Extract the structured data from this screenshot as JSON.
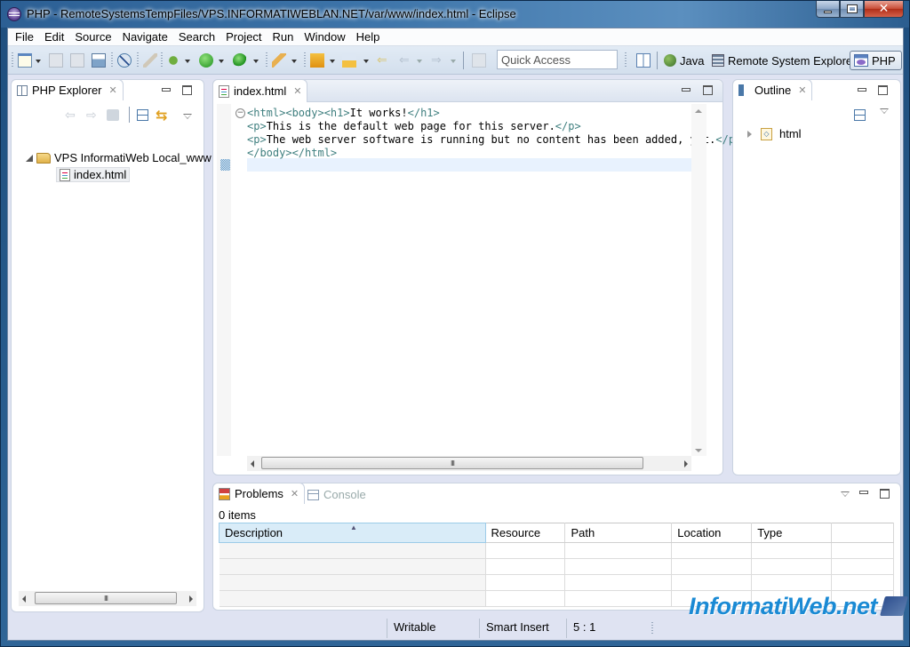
{
  "window": {
    "title": "PHP - RemoteSystemsTempFiles/VPS.INFORMATIWEBLAN.NET/var/www/index.html - Eclipse",
    "close_glyph": "✕"
  },
  "menu": [
    "File",
    "Edit",
    "Source",
    "Navigate",
    "Search",
    "Project",
    "Run",
    "Window",
    "Help"
  ],
  "toolbar": {
    "quick_access_placeholder": "Quick Access",
    "perspectives": [
      {
        "label": "Java",
        "active": false
      },
      {
        "label": "Remote System Explorer",
        "active": false
      },
      {
        "label": "PHP",
        "active": true
      }
    ]
  },
  "explorer": {
    "tab_label": "PHP Explorer",
    "close_glyph": "✕",
    "tree": [
      {
        "label": "VPS InformatiWeb Local_www",
        "type": "folder",
        "expanded": true
      },
      {
        "label": "index.html",
        "type": "file",
        "selected": true
      }
    ],
    "scroll_thumb": "III"
  },
  "editor": {
    "tab_label": "index.html",
    "close_glyph": "✕",
    "lines": [
      [
        {
          "t": "tag",
          "v": "<html><body><h1>"
        },
        {
          "t": "txt",
          "v": "It works!"
        },
        {
          "t": "tag",
          "v": "</h1>"
        }
      ],
      [
        {
          "t": "tag",
          "v": "<p>"
        },
        {
          "t": "txt",
          "v": "This is the default web page for this server."
        },
        {
          "t": "tag",
          "v": "</p>"
        }
      ],
      [
        {
          "t": "tag",
          "v": "<p>"
        },
        {
          "t": "txt",
          "v": "The web server software is running but no content has been added, yet."
        },
        {
          "t": "tag",
          "v": "</p>"
        }
      ],
      [
        {
          "t": "tag",
          "v": "</body></html>"
        }
      ],
      []
    ],
    "fold_glyph": "−",
    "scroll_thumb": "III"
  },
  "outline": {
    "tab_label": "Outline",
    "close_glyph": "✕",
    "items": [
      {
        "label": "html"
      }
    ]
  },
  "problems": {
    "tab_label": "Problems",
    "close_glyph": "✕",
    "console_label": "Console",
    "count_text": "0 items",
    "columns": [
      "Description",
      "Resource",
      "Path",
      "Location",
      "Type",
      ""
    ],
    "empty_rows": 4
  },
  "status": {
    "writable": "Writable",
    "insert_mode": "Smart Insert",
    "position": "5 : 1"
  },
  "watermark": "InformatiWeb.net"
}
